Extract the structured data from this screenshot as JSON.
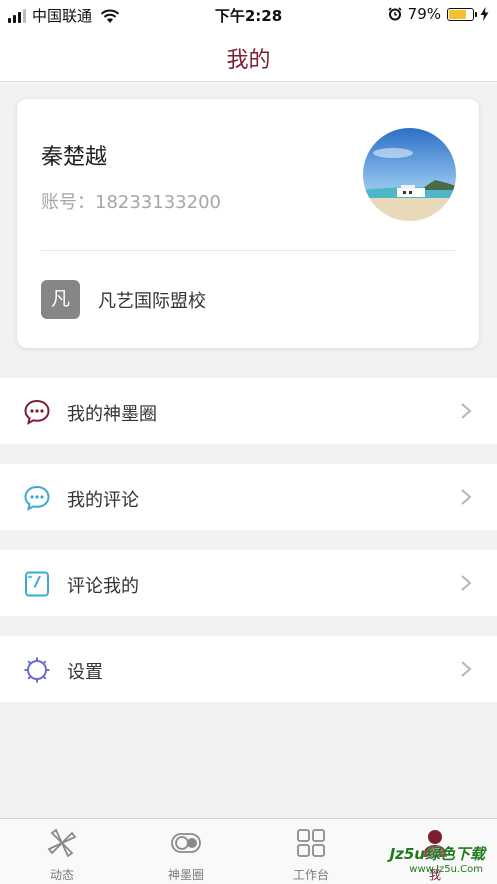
{
  "status_bar": {
    "carrier": "中国联通",
    "time": "下午2:28",
    "battery": "79%",
    "battery_level": 0.79
  },
  "nav": {
    "title": "我的"
  },
  "profile": {
    "name": "秦楚越",
    "account_label": "账号：18233133200",
    "school_badge": "凡",
    "school_name": "凡艺国际盟校"
  },
  "menu": [
    {
      "label": "我的神墨圈",
      "icon": "chat-bubble-icon",
      "color": "#7a1f33"
    },
    {
      "label": "我的评论",
      "icon": "comment-bubble-icon",
      "color": "#3aa9d8"
    },
    {
      "label": "评论我的",
      "icon": "note-icon",
      "color": "#3aa9d8"
    },
    {
      "label": "设置",
      "icon": "gear-icon",
      "color": "#6b6bd6"
    }
  ],
  "tabs": [
    {
      "label": "动态",
      "icon": "pinwheel-icon",
      "active": false
    },
    {
      "label": "神墨圈",
      "icon": "toggle-icon",
      "active": false
    },
    {
      "label": "工作台",
      "icon": "grid-icon",
      "active": false
    },
    {
      "label": "我",
      "icon": "user-icon",
      "active": true
    }
  ],
  "watermark": {
    "text": "Jz5u绿色下载",
    "sub": "www.Jz5u.Com"
  },
  "colors": {
    "accent": "#7a1f33",
    "tab_inactive": "#7a7a7a",
    "battery": "#f5c12e"
  }
}
